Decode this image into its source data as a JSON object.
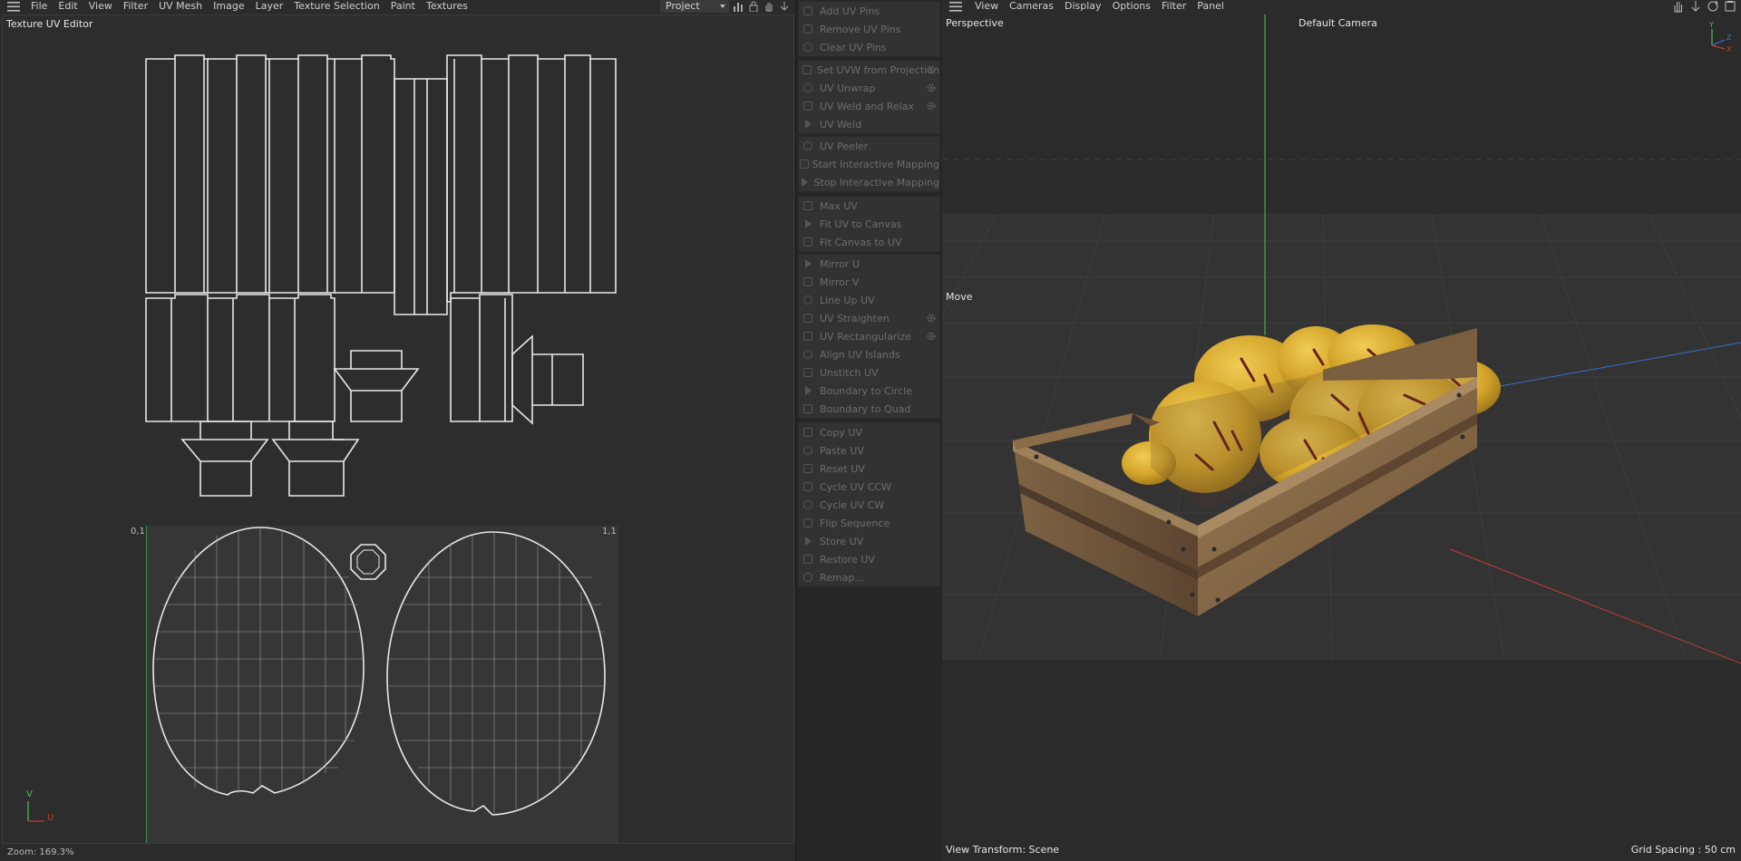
{
  "uv_editor": {
    "menu": [
      "File",
      "Edit",
      "View",
      "Filter",
      "UV Mesh",
      "Image",
      "Layer",
      "Texture Selection",
      "Paint",
      "Textures"
    ],
    "project_select": "Project",
    "title": "Texture UV Editor",
    "corner_left": "0,1",
    "corner_right": "1,1",
    "axis_v": "V",
    "axis_u": "U",
    "zoom": "Zoom: 169.3%"
  },
  "commands": {
    "groups": [
      [
        "Add UV Pins",
        "Remove UV Pins",
        "Clear UV Pins"
      ],
      [
        "Set UVW from Projection",
        "UV Unwrap",
        "UV Weld and Relax",
        "UV Weld"
      ],
      [
        "UV Peeler",
        "Start Interactive Mapping",
        "Stop Interactive Mapping"
      ],
      [
        "Max UV",
        "Fit UV to Canvas",
        "Fit Canvas to UV"
      ],
      [
        "Mirror U",
        "Mirror V",
        "Line Up UV",
        "UV Straighten",
        "UV Rectangularize",
        "Align UV Islands",
        "Unstitch UV",
        "Boundary to Circle",
        "Boundary to Quad"
      ],
      [
        "Copy UV",
        "Paste UV",
        "Reset UV",
        "Cycle UV CCW",
        "Cycle UV CW",
        "Flip Sequence",
        "Store UV",
        "Restore UV",
        "Remap..."
      ]
    ],
    "gear_items": [
      "Set UVW from Projection",
      "UV Unwrap",
      "UV Weld and Relax",
      "UV Straighten",
      "UV Rectangularize"
    ]
  },
  "viewport": {
    "menu": [
      "View",
      "Cameras",
      "Display",
      "Options",
      "Filter",
      "Panel"
    ],
    "view_name": "Perspective",
    "camera": "Default Camera",
    "tool": "Move",
    "view_transform": "View Transform: Scene",
    "grid_spacing": "Grid Spacing : 50 cm",
    "axis": {
      "y": "Y",
      "z": "Z",
      "x": "X"
    }
  },
  "colors": {
    "y_axis": "#4fbf5a",
    "x_axis": "#c23a3a",
    "z_axis": "#3a6fd0",
    "fruit": "#d8aa2a",
    "crate": "#8a6c48"
  }
}
